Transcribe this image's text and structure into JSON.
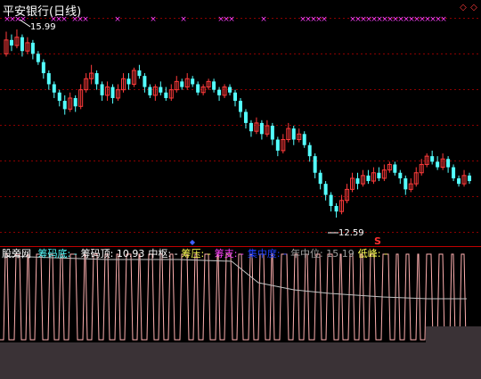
{
  "window": {
    "title": "平安银行(日线)"
  },
  "main_chart": {
    "high_label": "15.99",
    "low_label": "12.59",
    "gridline_count": 7,
    "candle_up_color": "#ff3b3b",
    "candle_down_color": "#54ffff",
    "marker_x_color": "#ff40ff",
    "marker_glyph": "×",
    "signal_glyph": "S",
    "signal_color": "#ff3030",
    "arrow_glyph": "◆"
  },
  "indicator": {
    "name": "股旁网",
    "legend": [
      {
        "label": "筹码底:",
        "value": "-",
        "color": "#54ffff"
      },
      {
        "label": "筹码顶:",
        "value": "10.93",
        "color": "#ffffff"
      },
      {
        "label": "中枢:",
        "value": "-",
        "color": "#ffffff"
      },
      {
        "label": "筹压:",
        "value": "-",
        "color": "#ffff54"
      },
      {
        "label": "筹支:",
        "value": "-",
        "color": "#ff40ff"
      },
      {
        "label": "集中度:",
        "value": "-",
        "color": "#2040ff"
      },
      {
        "label": "年中位:",
        "value": "15.19",
        "color": "#a0a0a0"
      },
      {
        "label": "低峰:",
        "value": "-",
        "color": "#ffff54"
      }
    ],
    "line_color": "#ffb0b0",
    "mid_line_color": "#c0c0c0"
  },
  "chart_data": {
    "type": "candlestick",
    "title": "平安银行(日线)",
    "annotations": [
      "15.99",
      "12.59"
    ],
    "ylim": [
      12.3,
      16.2
    ],
    "candles": [
      [
        15.55,
        15.8,
        15.95,
        15.5
      ],
      [
        15.8,
        15.7,
        15.9,
        15.6
      ],
      [
        15.7,
        15.85,
        15.99,
        15.65
      ],
      [
        15.85,
        15.6,
        15.9,
        15.5
      ],
      [
        15.6,
        15.75,
        15.85,
        15.55
      ],
      [
        15.75,
        15.55,
        15.8,
        15.45
      ],
      [
        15.55,
        15.4,
        15.6,
        15.35
      ],
      [
        15.4,
        15.2,
        15.45,
        15.1
      ],
      [
        15.2,
        15.0,
        15.25,
        14.9
      ],
      [
        15.0,
        14.85,
        15.05,
        14.75
      ],
      [
        14.85,
        14.7,
        14.9,
        14.6
      ],
      [
        14.7,
        14.55,
        14.8,
        14.45
      ],
      [
        14.55,
        14.75,
        14.85,
        14.5
      ],
      [
        14.75,
        14.6,
        14.8,
        14.5
      ],
      [
        14.6,
        14.9,
        15.0,
        14.55
      ],
      [
        14.9,
        15.1,
        15.2,
        14.85
      ],
      [
        15.1,
        15.2,
        15.35,
        15.0
      ],
      [
        15.2,
        15.0,
        15.25,
        14.9
      ],
      [
        15.0,
        14.8,
        15.05,
        14.7
      ],
      [
        14.8,
        14.95,
        15.05,
        14.7
      ],
      [
        14.95,
        14.75,
        15.0,
        14.65
      ],
      [
        14.75,
        14.9,
        15.0,
        14.7
      ],
      [
        14.9,
        15.1,
        15.2,
        14.85
      ],
      [
        15.1,
        15.0,
        15.2,
        14.9
      ],
      [
        15.0,
        15.25,
        15.3,
        14.95
      ],
      [
        15.25,
        15.15,
        15.35,
        15.1
      ],
      [
        15.15,
        14.95,
        15.2,
        14.85
      ],
      [
        14.95,
        14.8,
        15.0,
        14.75
      ],
      [
        14.8,
        14.95,
        15.0,
        14.7
      ],
      [
        14.95,
        14.85,
        15.05,
        14.8
      ],
      [
        14.85,
        14.75,
        14.95,
        14.7
      ],
      [
        14.75,
        14.9,
        15.0,
        14.7
      ],
      [
        14.9,
        15.05,
        15.15,
        14.85
      ],
      [
        15.05,
        14.95,
        15.1,
        14.9
      ],
      [
        14.95,
        15.1,
        15.2,
        14.9
      ],
      [
        15.1,
        15.0,
        15.15,
        14.95
      ],
      [
        15.0,
        14.85,
        15.05,
        14.8
      ],
      [
        14.85,
        14.95,
        15.0,
        14.8
      ],
      [
        14.95,
        15.05,
        15.1,
        14.9
      ],
      [
        15.05,
        14.9,
        15.1,
        14.85
      ],
      [
        14.9,
        14.8,
        14.95,
        14.7
      ],
      [
        14.8,
        14.95,
        15.0,
        14.75
      ],
      [
        14.95,
        14.85,
        15.0,
        14.8
      ],
      [
        14.85,
        14.7,
        14.9,
        14.6
      ],
      [
        14.7,
        14.5,
        14.75,
        14.4
      ],
      [
        14.5,
        14.3,
        14.55,
        14.2
      ],
      [
        14.3,
        14.15,
        14.35,
        14.05
      ],
      [
        14.15,
        14.3,
        14.4,
        14.1
      ],
      [
        14.3,
        14.1,
        14.35,
        14.0
      ],
      [
        14.1,
        14.25,
        14.35,
        14.05
      ],
      [
        14.25,
        14.0,
        14.3,
        13.9
      ],
      [
        14.0,
        13.8,
        14.05,
        13.7
      ],
      [
        13.8,
        14.0,
        14.1,
        13.75
      ],
      [
        14.0,
        14.2,
        14.3,
        13.95
      ],
      [
        14.2,
        14.0,
        14.25,
        13.9
      ],
      [
        14.0,
        14.1,
        14.2,
        13.95
      ],
      [
        14.1,
        13.9,
        14.15,
        13.85
      ],
      [
        13.9,
        13.7,
        13.95,
        13.6
      ],
      [
        13.7,
        13.4,
        13.75,
        13.3
      ],
      [
        13.4,
        13.2,
        13.45,
        13.1
      ],
      [
        13.2,
        13.0,
        13.25,
        12.9
      ],
      [
        13.0,
        12.8,
        13.05,
        12.7
      ],
      [
        12.8,
        12.7,
        12.85,
        12.59
      ],
      [
        12.7,
        12.9,
        13.0,
        12.65
      ],
      [
        12.9,
        13.1,
        13.2,
        12.85
      ],
      [
        13.1,
        13.3,
        13.4,
        13.05
      ],
      [
        13.3,
        13.2,
        13.4,
        13.1
      ],
      [
        13.2,
        13.35,
        13.45,
        13.15
      ],
      [
        13.35,
        13.25,
        13.45,
        13.2
      ],
      [
        13.25,
        13.4,
        13.5,
        13.2
      ],
      [
        13.4,
        13.3,
        13.5,
        13.25
      ],
      [
        13.3,
        13.45,
        13.55,
        13.25
      ],
      [
        13.45,
        13.55,
        13.6,
        13.4
      ],
      [
        13.55,
        13.4,
        13.6,
        13.35
      ],
      [
        13.4,
        13.3,
        13.45,
        13.2
      ],
      [
        13.3,
        13.1,
        13.35,
        13.0
      ],
      [
        13.1,
        13.2,
        13.3,
        13.05
      ],
      [
        13.2,
        13.4,
        13.5,
        13.15
      ],
      [
        13.4,
        13.55,
        13.65,
        13.35
      ],
      [
        13.55,
        13.7,
        13.75,
        13.5
      ],
      [
        13.7,
        13.6,
        13.8,
        13.55
      ],
      [
        13.6,
        13.5,
        13.7,
        13.45
      ],
      [
        13.5,
        13.65,
        13.75,
        13.45
      ],
      [
        13.65,
        13.5,
        13.7,
        13.4
      ],
      [
        13.5,
        13.3,
        13.55,
        13.25
      ],
      [
        13.3,
        13.2,
        13.35,
        13.15
      ],
      [
        13.2,
        13.35,
        13.45,
        13.15
      ],
      [
        13.35,
        13.25,
        13.4,
        13.2
      ]
    ]
  }
}
